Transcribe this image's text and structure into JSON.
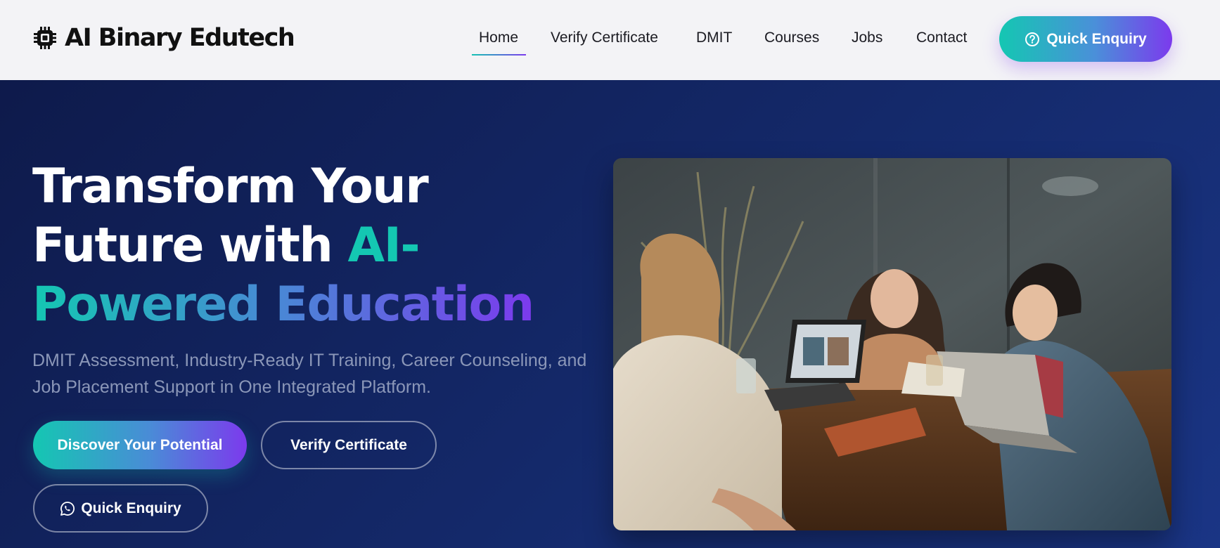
{
  "brand": {
    "name": "AI Binary Edutech",
    "icon": "chip-icon"
  },
  "nav": {
    "items": [
      {
        "label": "Home",
        "active": true
      },
      {
        "label": "Verify Certificate",
        "active": false
      },
      {
        "label": "DMIT",
        "active": false
      },
      {
        "label": "Courses",
        "active": false
      },
      {
        "label": "Jobs",
        "active": false
      },
      {
        "label": "Contact",
        "active": false
      }
    ],
    "cta": {
      "label": "Quick Enquiry",
      "icon": "question-circle-icon"
    }
  },
  "hero": {
    "title": {
      "line1": "Transform Your",
      "line2_plain": "Future with ",
      "line2_accent": "AI-",
      "line3_accent": "Powered Education"
    },
    "subtitle": "DMIT Assessment, Industry-Ready IT Training, Career Counseling, and Job Placement Support in One Integrated Platform.",
    "buttons": {
      "primary": "Discover Your Potential",
      "verify": "Verify Certificate",
      "enquiry": "Quick Enquiry",
      "enquiry_icon": "whatsapp-icon"
    },
    "image_subject": "three-people-laughing-at-laptops"
  },
  "colors": {
    "accent_start": "#14c7b2",
    "accent_end": "#7c3aed",
    "hero_bg": "#14296a",
    "header_bg": "#f3f3f6"
  }
}
